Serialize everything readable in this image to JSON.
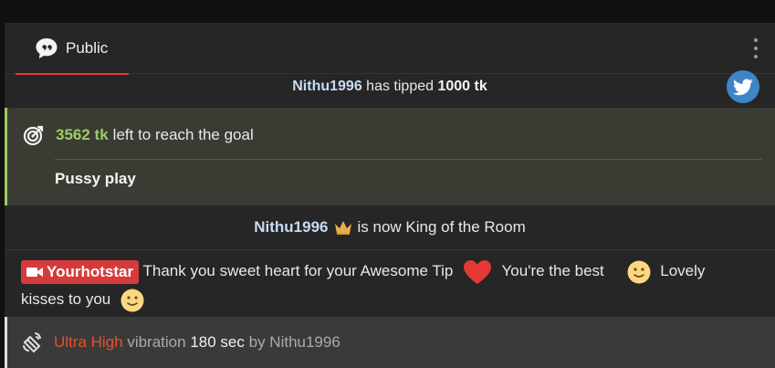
{
  "tabs": [
    {
      "label": "Public",
      "icon": "chat-bubble-icon",
      "active": true
    }
  ],
  "menu": {
    "icon": "kebab-menu-icon"
  },
  "tip": {
    "user": "Nithu1996",
    "text": "has tipped",
    "amount": "1000 tk"
  },
  "twitter": {
    "icon": "twitter-icon",
    "color": "#3d86c6"
  },
  "goal": {
    "amount": "3562 tk",
    "text": "left to reach the goal",
    "name": "Pussy play",
    "accent": "#9ccc65"
  },
  "king": {
    "user": "Nithu1996",
    "text": "is now King of the Room"
  },
  "message": {
    "sender": "Yourhotstar",
    "part1": "Thank you sweet heart for your Awesome Tip",
    "part2": "You're the best",
    "part3": "Lovely",
    "part4": "kisses to you",
    "badge_color": "#d63b3b"
  },
  "vibration": {
    "level": "Ultra High",
    "word": "vibration",
    "duration": "180 sec",
    "by": "by Nithu1996",
    "level_color": "#e8502b"
  }
}
